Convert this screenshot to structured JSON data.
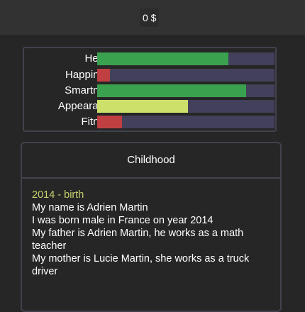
{
  "header": {
    "money": "0 $"
  },
  "stats": [
    {
      "label": "Health:",
      "value": 0.74,
      "color": "#3aa14f"
    },
    {
      "label": "Happiness:",
      "value": 0.07,
      "color": "#c04041"
    },
    {
      "label": "Smartness:",
      "value": 0.84,
      "color": "#3aa14f"
    },
    {
      "label": "Appearance:",
      "value": 0.51,
      "color": "#cce06a"
    },
    {
      "label": "Fitness:",
      "value": 0.14,
      "color": "#c04041"
    }
  ],
  "life": {
    "stage": "Childhood",
    "log": [
      {
        "year": "2014 - birth",
        "lines": [
          "My name is Adrien Martin",
          "I was born male in France on year 2014",
          "My father is Adrien Martin, he works as a math teacher",
          "My mother is Lucie Martin, she works as a truck driver"
        ]
      }
    ]
  }
}
